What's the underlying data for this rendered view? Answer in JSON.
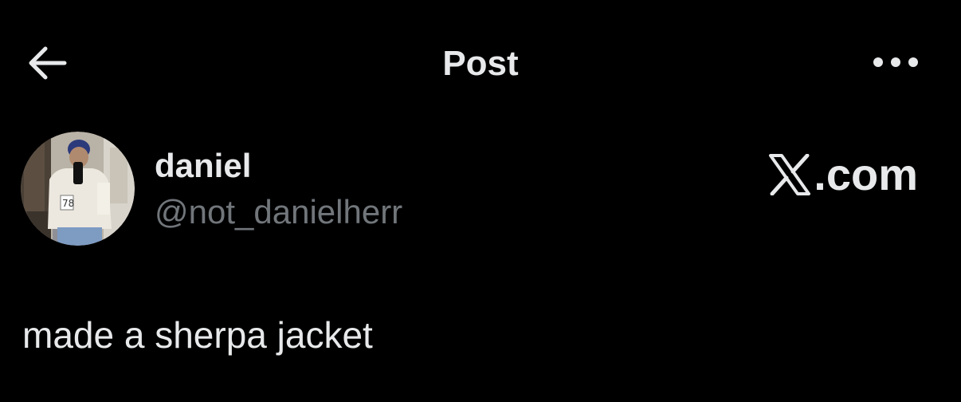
{
  "header": {
    "title": "Post",
    "back_icon": "arrow-left-icon",
    "more_icon": "more-horizontal-icon"
  },
  "author": {
    "display_name": "daniel",
    "handle": "@not_danielherr",
    "avatar": "profile-photo"
  },
  "brand": {
    "text": ".com",
    "icon": "x-logo-icon"
  },
  "post": {
    "text": "made a sherpa jacket"
  },
  "colors": {
    "background": "#000000",
    "text_primary": "#e7e9ea",
    "text_secondary": "#71767b"
  }
}
